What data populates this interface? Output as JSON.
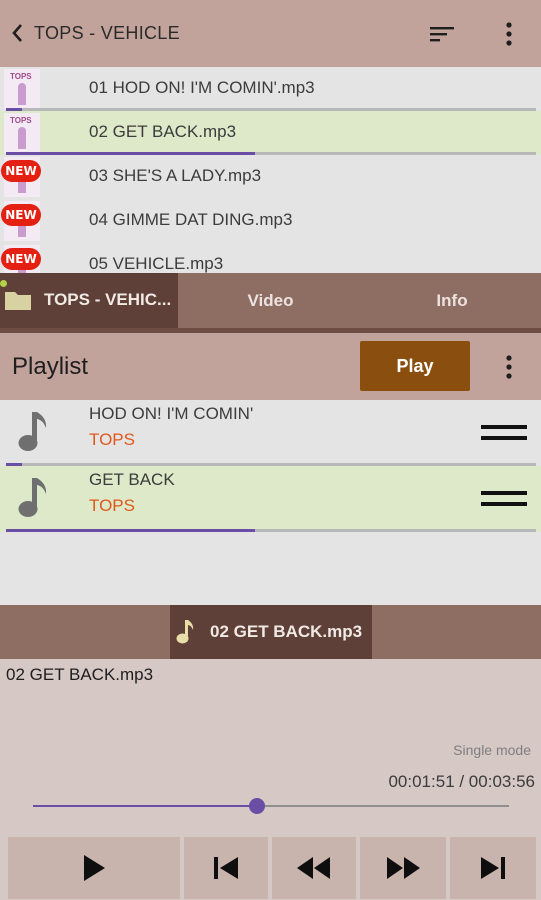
{
  "header": {
    "title": "TOPS - VEHICLE",
    "back_icon": "chevron-left-icon",
    "sort_icon": "sort-icon",
    "more_icon": "more-vert-icon"
  },
  "files": [
    {
      "name": "01 HOD ON! I'M COMIN'.mp3",
      "thumb": "album-art",
      "progress": 0.03
    },
    {
      "name": "02 GET BACK.mp3",
      "thumb": "album-art",
      "progress": 0.47,
      "selected": true
    },
    {
      "name": "03 SHE'S A LADY.mp3",
      "thumb": "new",
      "badge": "NEW"
    },
    {
      "name": "04 GIMME DAT DING.mp3",
      "thumb": "new",
      "badge": "NEW"
    },
    {
      "name": "05 VEHICLE.mp3",
      "thumb": "new",
      "badge": "NEW"
    }
  ],
  "thumb_text": "TOPS",
  "tabs": [
    {
      "label": "TOPS - VEHIC...",
      "icon": "folder-icon",
      "active": true
    },
    {
      "label": "Video"
    },
    {
      "label": "Info"
    }
  ],
  "playlist": {
    "title": "Playlist",
    "play_label": "Play",
    "items": [
      {
        "title": "HOD ON! I'M COMIN'",
        "artist": "TOPS",
        "progress": 0.03
      },
      {
        "title": "GET BACK",
        "artist": "TOPS",
        "progress": 0.47,
        "selected": true
      }
    ]
  },
  "now_playing": {
    "chip_label": "02 GET BACK.mp3",
    "file_name": "02 GET BACK.mp3",
    "mode": "Single mode",
    "time": "00:01:51 / 00:03:56",
    "progress": 0.47
  },
  "controls": [
    "play-icon",
    "skip-previous-icon",
    "rewind-icon",
    "fast-forward-icon",
    "skip-next-icon"
  ],
  "colors": {
    "header": "#c2a39b",
    "tab_bar": "#8e6d63",
    "tab_active": "#5e4038",
    "play_button": "#8a4f0e",
    "accent": "#6a4ea6",
    "artist": "#e0581c",
    "selected_row": "#dde9c9",
    "badge": "#e32012"
  }
}
